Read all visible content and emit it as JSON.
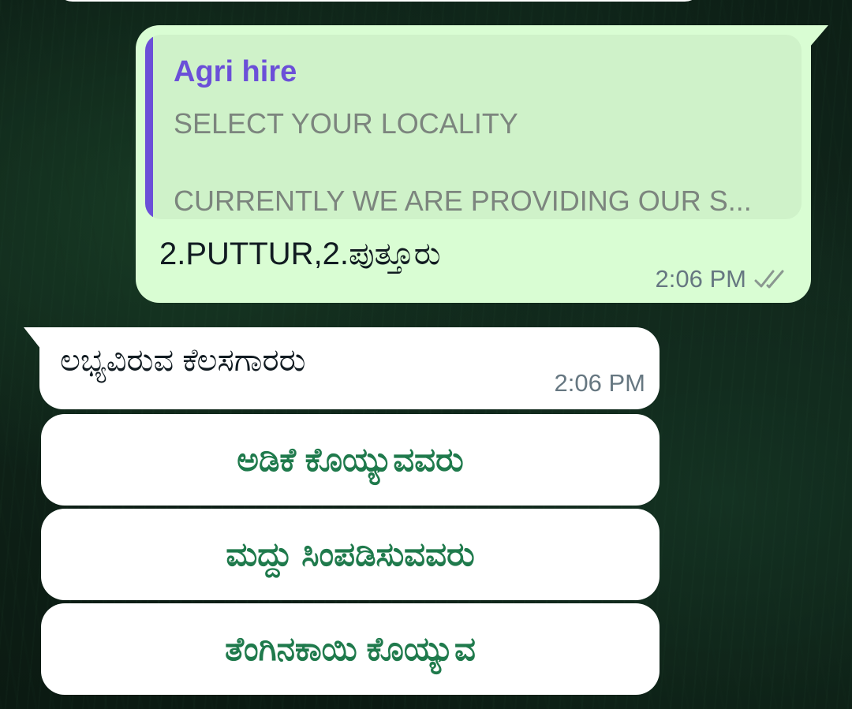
{
  "chat": {
    "outgoing": {
      "quoted_author": "Agri hire",
      "quoted_line1": "SELECT YOUR LOCALITY",
      "quoted_line2": "CURRENTLY WE ARE PROVIDING OUR S...",
      "text": "2.PUTTUR,2.ಪುತ್ತೂರು",
      "time": "2:06 PM",
      "status": "read"
    },
    "incoming": {
      "text": "ಲಭ್ಯವಿರುವ ಕೆಲಸಗಾರರು",
      "time": "2:06 PM"
    },
    "reply_buttons": [
      {
        "label": "ಅಡಿಕೆ ಕೊಯ್ಯುವವರು"
      },
      {
        "label": "ಮದ್ದು ಸಿಂಪಡಿಸುವವರು"
      },
      {
        "label": "ತೆಂಗಿನಕಾಯಿ  ಕೊಯ್ಯುವ"
      }
    ]
  },
  "colors": {
    "outgoing_bubble": "#d9fdd3",
    "quote_accent": "#6b4fd8",
    "button_text": "#1f7a4c",
    "read_ticks": "#8a9790"
  },
  "icons": {
    "status": "double-check-icon"
  }
}
